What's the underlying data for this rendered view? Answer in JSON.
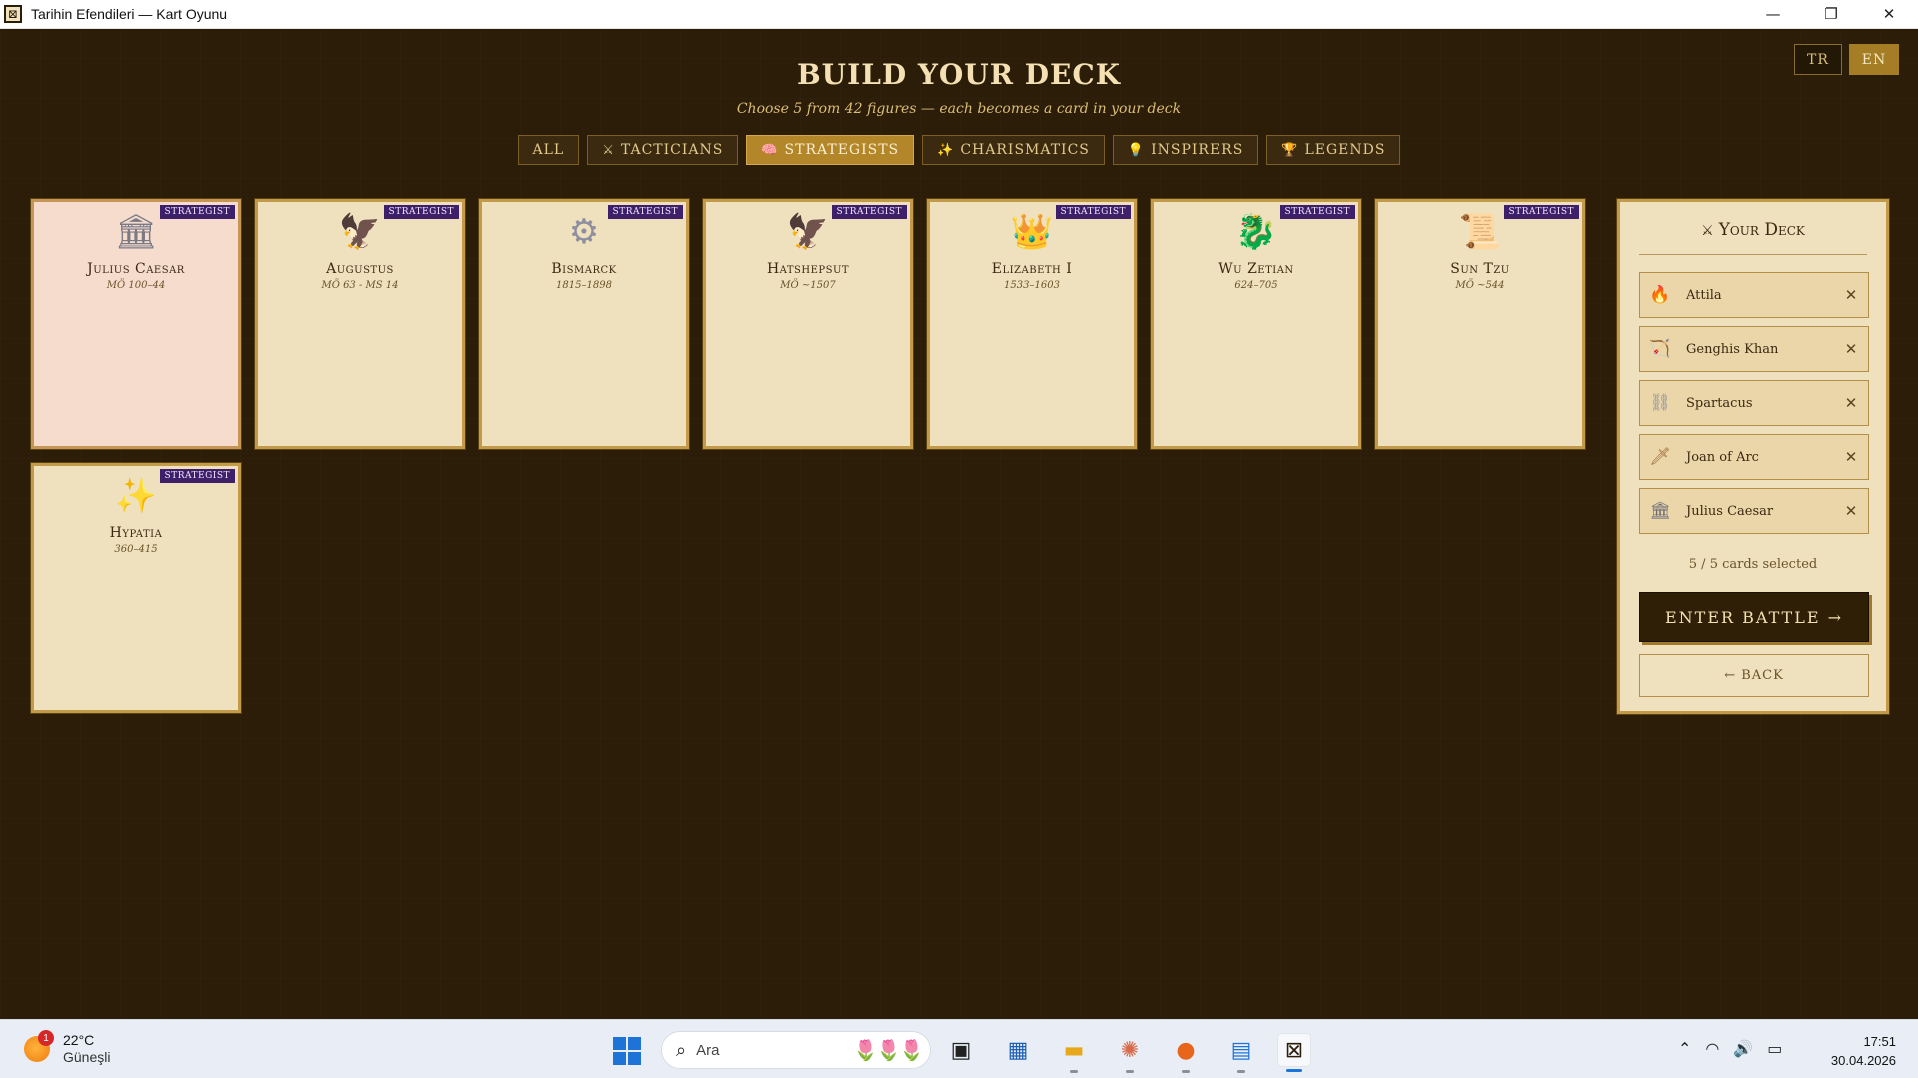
{
  "window": {
    "title": "Tarihin Efendileri — Kart Oyunu",
    "app_icon": "⊠",
    "controls": {
      "minimize": "—",
      "maximize": "❐",
      "close": "✕"
    }
  },
  "language": {
    "tr": "TR",
    "en": "EN",
    "active": "EN"
  },
  "header": {
    "title": "BUILD YOUR DECK",
    "subtitle": "Choose 5 from 42 figures — each becomes a card in your deck"
  },
  "filters": [
    {
      "label": "All",
      "icon": "",
      "active": false
    },
    {
      "label": "Tacticians",
      "icon": "⚔",
      "active": false
    },
    {
      "label": "Strategists",
      "icon": "🧠",
      "active": true
    },
    {
      "label": "Charismatics",
      "icon": "✨",
      "active": false
    },
    {
      "label": "Inspirers",
      "icon": "💡",
      "active": false
    },
    {
      "label": "Legends",
      "icon": "🏆",
      "active": false
    }
  ],
  "cards": [
    {
      "name": "Julius Caesar",
      "era": "MÖ 100–44",
      "badge": "Strategist",
      "icon": "🏛",
      "icon_color": "#7a7a86",
      "selected": true
    },
    {
      "name": "Augustus",
      "era": "MÖ 63 - MS 14",
      "badge": "Strategist",
      "icon": "🦅",
      "icon_color": "#6b3a1e",
      "selected": false
    },
    {
      "name": "Bismarck",
      "era": "1815–1898",
      "badge": "Strategist",
      "icon": "⚙",
      "icon_color": "#8f8ea0",
      "selected": false
    },
    {
      "name": "Hatshepsut",
      "era": "MÖ ~1507",
      "badge": "Strategist",
      "icon": "🦅",
      "icon_color": "#6b3a1e",
      "selected": false
    },
    {
      "name": "Elizabeth I",
      "era": "1533–1603",
      "badge": "Strategist",
      "icon": "👑",
      "icon_color": "#e3a21a",
      "selected": false
    },
    {
      "name": "Wu Zetian",
      "era": "624–705",
      "badge": "Strategist",
      "icon": "🐉",
      "icon_color": "#2f9e44",
      "selected": false
    },
    {
      "name": "Sun Tzu",
      "era": "MÖ ~544",
      "badge": "Strategist",
      "icon": "📜",
      "icon_color": "#e6b46a",
      "selected": false
    },
    {
      "name": "Hypatia",
      "era": "360–415",
      "badge": "Strategist",
      "icon": "✨",
      "icon_color": "#f0b400",
      "selected": false
    }
  ],
  "deck": {
    "title": "Your Deck",
    "title_icon": "⚔",
    "items": [
      {
        "name": "Attila",
        "icon": "🔥",
        "icon_color": "#e8590c",
        "remove": "✕"
      },
      {
        "name": "Genghis Khan",
        "icon": "🏹",
        "icon_color": "#7a4a1e",
        "remove": "✕"
      },
      {
        "name": "Spartacus",
        "icon": "⛓",
        "icon_color": "#8d8d96",
        "remove": "✕"
      },
      {
        "name": "Joan of Arc",
        "icon": "🗡",
        "icon_color": "#9c6a3a",
        "remove": "✕"
      },
      {
        "name": "Julius Caesar",
        "icon": "🏛",
        "icon_color": "#6d6d78",
        "remove": "✕"
      }
    ],
    "count_text": "5 / 5 cards selected",
    "enter_label": "Enter Battle →",
    "back_label": "← Back"
  },
  "taskbar": {
    "weather": {
      "temp": "22°C",
      "condition": "Güneşli",
      "badge": "1"
    },
    "search_placeholder": "Ara",
    "search_icon": "⌕",
    "search_decoration": "🌷🌷🌷",
    "apps": [
      {
        "name": "task-view",
        "glyph": "▣",
        "color": "#222222",
        "running": false,
        "active": false
      },
      {
        "name": "store",
        "glyph": "▦",
        "color": "#1e5fb4",
        "running": false,
        "active": false
      },
      {
        "name": "file-explorer",
        "glyph": "▬",
        "color": "#e7a91b",
        "running": true,
        "active": false
      },
      {
        "name": "claude",
        "glyph": "✺",
        "color": "#d86a4a",
        "running": true,
        "active": false
      },
      {
        "name": "firefox",
        "glyph": "●",
        "color": "#e8661c",
        "running": true,
        "active": false
      },
      {
        "name": "notepad",
        "glyph": "▤",
        "color": "#1e74d6",
        "running": true,
        "active": false
      },
      {
        "name": "game",
        "glyph": "⊠",
        "color": "#2b1d08",
        "running": true,
        "active": true
      }
    ],
    "tray": {
      "chevron": "⌃",
      "wifi": "◠",
      "volume": "🔊",
      "battery": "▭"
    },
    "time": "17:51",
    "date": "30.04.2026"
  }
}
